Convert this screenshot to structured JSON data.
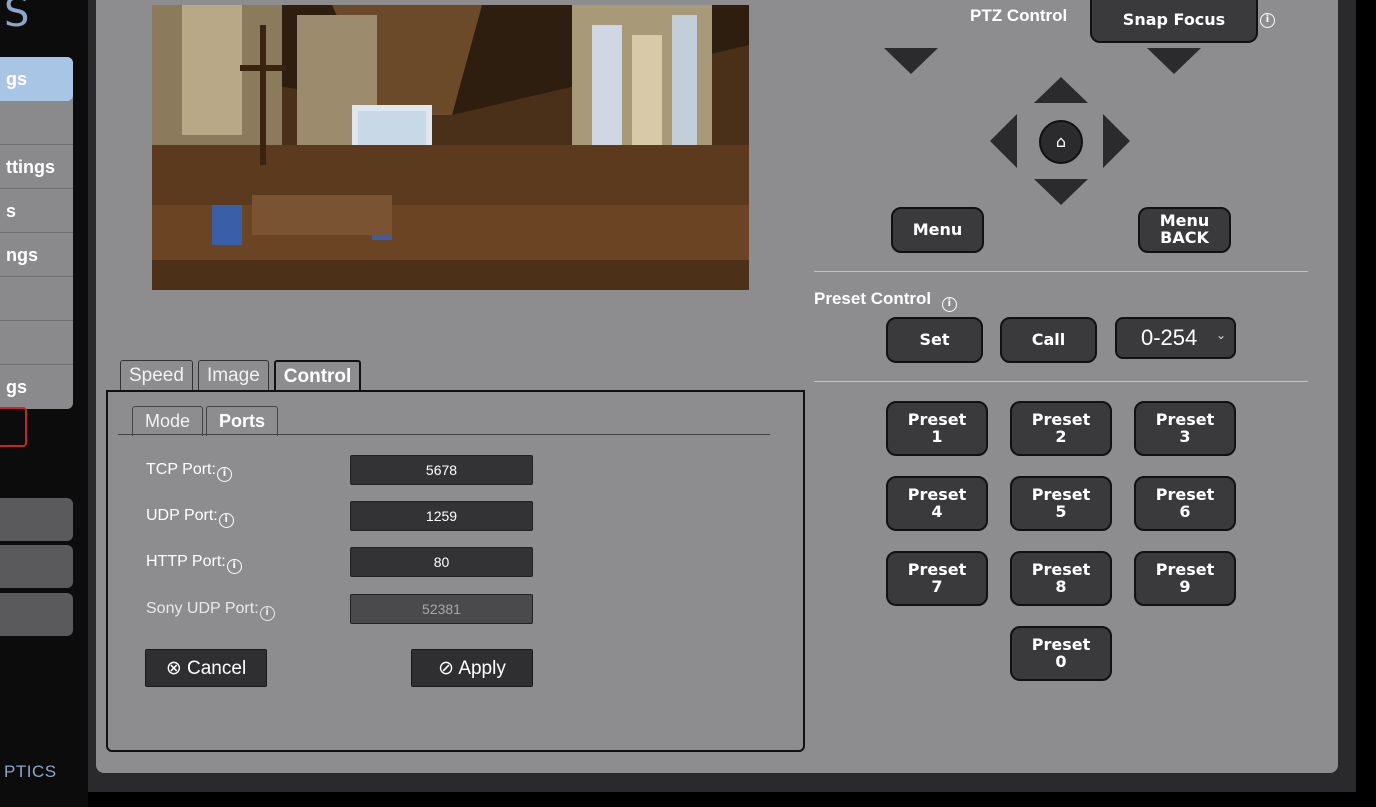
{
  "sidebar": {
    "logo": "S",
    "items": [
      {
        "label": "gs",
        "active": true
      },
      {
        "label": "",
        "active": false
      },
      {
        "label": "ttings",
        "active": false
      },
      {
        "label": "s",
        "active": false
      },
      {
        "label": "ngs",
        "active": false
      },
      {
        "label": "",
        "active": false
      },
      {
        "label": "",
        "active": false
      },
      {
        "label": "gs",
        "active": false
      }
    ],
    "footer": "PTICS"
  },
  "tabs": [
    {
      "label": "Speed",
      "active": false
    },
    {
      "label": "Image",
      "active": false
    },
    {
      "label": "Control",
      "active": true
    }
  ],
  "subtabs": [
    {
      "label": "Mode",
      "active": false
    },
    {
      "label": "Ports",
      "active": true
    }
  ],
  "ports": {
    "tcp": {
      "label": "TCP Port:",
      "value": "5678"
    },
    "udp": {
      "label": "UDP Port:",
      "value": "1259"
    },
    "http": {
      "label": "HTTP Port:",
      "value": "80"
    },
    "sony": {
      "label": "Sony UDP Port:",
      "value": "52381"
    }
  },
  "actions": {
    "cancel": "Cancel",
    "apply": "Apply"
  },
  "ptz": {
    "title": "PTZ Control",
    "snap_focus": "Snap Focus",
    "menu": "Menu",
    "menu_back_line1": "Menu",
    "menu_back_line2": "BACK"
  },
  "preset": {
    "title": "Preset Control",
    "set": "Set",
    "call": "Call",
    "range": "0-254",
    "word": "Preset",
    "numbers": [
      "1",
      "2",
      "3",
      "4",
      "5",
      "6",
      "7",
      "8",
      "9",
      "0"
    ]
  },
  "icons": {
    "home": "home-icon",
    "info": "info-icon",
    "cancel": "circle-x-icon",
    "apply": "circle-check-icon"
  },
  "colors": {
    "panel": "#8d8d90",
    "button": "#3a3a3c",
    "active_sidebar": "#a9c5e6",
    "alert": "#c4262e"
  }
}
